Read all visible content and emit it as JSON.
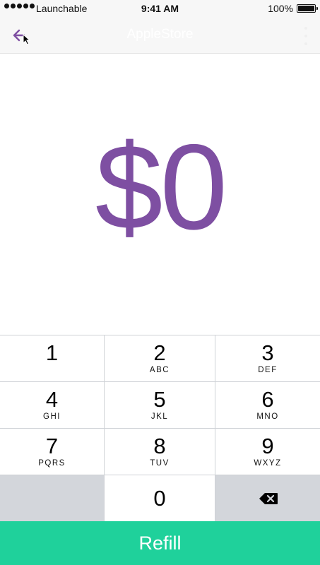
{
  "status_bar": {
    "carrier": "Launchable",
    "time": "9:41 AM",
    "battery": "100%"
  },
  "nav_bar": {
    "title": "AppleStore",
    "back_icon": "arrow-left-icon",
    "more_icon": "more-vertical-icon"
  },
  "amount": {
    "display": "$0"
  },
  "keypad": {
    "keys": [
      {
        "digit": "1",
        "letters": ""
      },
      {
        "digit": "2",
        "letters": "ABC"
      },
      {
        "digit": "3",
        "letters": "DEF"
      },
      {
        "digit": "4",
        "letters": "GHI"
      },
      {
        "digit": "5",
        "letters": "JKL"
      },
      {
        "digit": "6",
        "letters": "MNO"
      },
      {
        "digit": "7",
        "letters": "PQRS"
      },
      {
        "digit": "8",
        "letters": "TUV"
      },
      {
        "digit": "9",
        "letters": "WXYZ"
      },
      {
        "digit": "0",
        "letters": ""
      }
    ],
    "delete_icon": "backspace-icon"
  },
  "refill_button": {
    "label": "Refill"
  },
  "colors": {
    "accent": "#7e4fa2",
    "refill": "#1fd19b",
    "keypad_gray": "#d3d6db"
  }
}
